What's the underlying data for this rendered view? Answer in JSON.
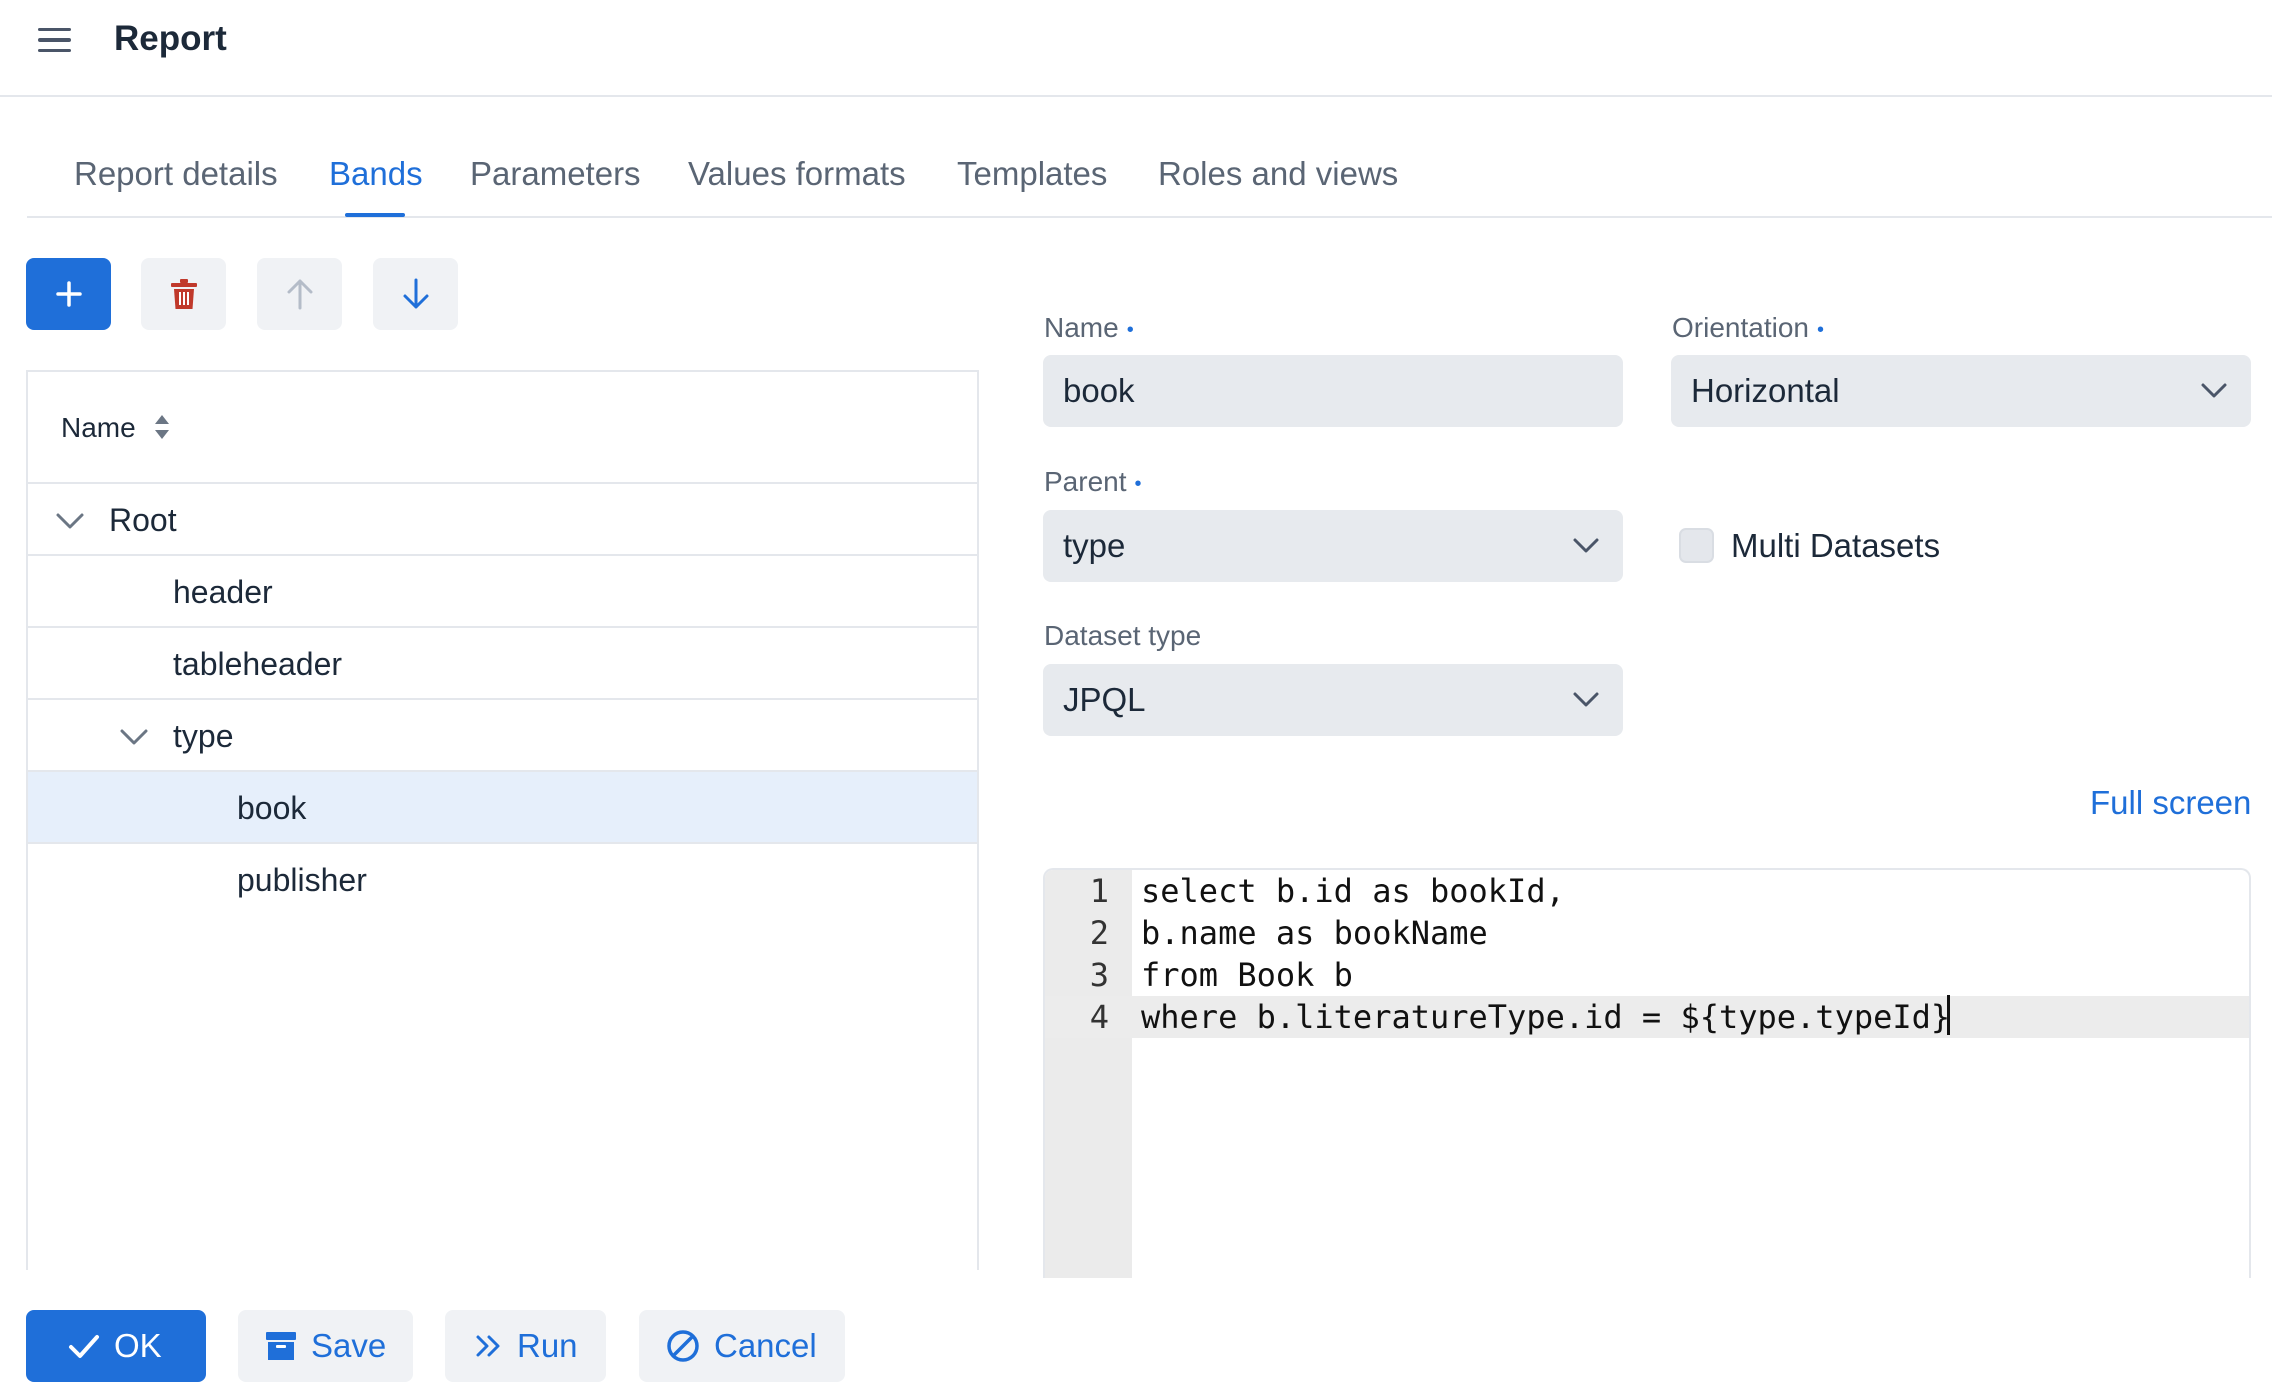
{
  "header": {
    "menu_icon": "hamburger-menu-icon",
    "title": "Report"
  },
  "tabs": [
    {
      "label": "Report details",
      "active": false
    },
    {
      "label": "Bands",
      "active": true
    },
    {
      "label": "Parameters",
      "active": false
    },
    {
      "label": "Values formats",
      "active": false
    },
    {
      "label": "Templates",
      "active": false
    },
    {
      "label": "Roles and views",
      "active": false
    }
  ],
  "toolbar": {
    "buttons": [
      {
        "name": "add-band-button",
        "icon": "plus-icon",
        "enabled": true
      },
      {
        "name": "delete-band-button",
        "icon": "trash-icon",
        "enabled": true
      },
      {
        "name": "move-up-button",
        "icon": "arrow-up-icon",
        "enabled": false
      },
      {
        "name": "move-down-button",
        "icon": "arrow-down-icon",
        "enabled": true
      }
    ]
  },
  "bands_tree": {
    "column_header": "Name",
    "rows": [
      {
        "label": "Root",
        "level": 0,
        "expanded": true,
        "selected": false
      },
      {
        "label": "header",
        "level": 1,
        "expanded": null,
        "selected": false
      },
      {
        "label": "tableheader",
        "level": 1,
        "expanded": null,
        "selected": false
      },
      {
        "label": "type",
        "level": 1,
        "expanded": true,
        "selected": false
      },
      {
        "label": "book",
        "level": 2,
        "expanded": null,
        "selected": true
      },
      {
        "label": "publisher",
        "level": 2,
        "expanded": null,
        "selected": false
      }
    ]
  },
  "form": {
    "name": {
      "label": "Name",
      "required": true,
      "value": "book"
    },
    "orientation": {
      "label": "Orientation",
      "required": true,
      "value": "Horizontal"
    },
    "parent": {
      "label": "Parent",
      "required": true,
      "value": "type"
    },
    "multi_datasets": {
      "label": "Multi Datasets",
      "checked": false
    },
    "dataset_type": {
      "label": "Dataset type",
      "value": "JPQL"
    },
    "full_screen_link": "Full screen"
  },
  "editor": {
    "lines": [
      {
        "number": "1",
        "text": "select b.id as bookId,"
      },
      {
        "number": "2",
        "text": "b.name as bookName"
      },
      {
        "number": "3",
        "text": "from Book b"
      },
      {
        "number": "4",
        "text": "where b.literatureType.id = ${type.typeId}"
      }
    ],
    "active_line": 4
  },
  "footer": {
    "ok_label": "OK",
    "save_label": "Save",
    "run_label": "Run",
    "cancel_label": "Cancel"
  },
  "colors": {
    "accent": "#1f6fd9",
    "danger": "#c0392b",
    "selected_row": "#e6effb",
    "field_bg": "#e7eaee"
  }
}
